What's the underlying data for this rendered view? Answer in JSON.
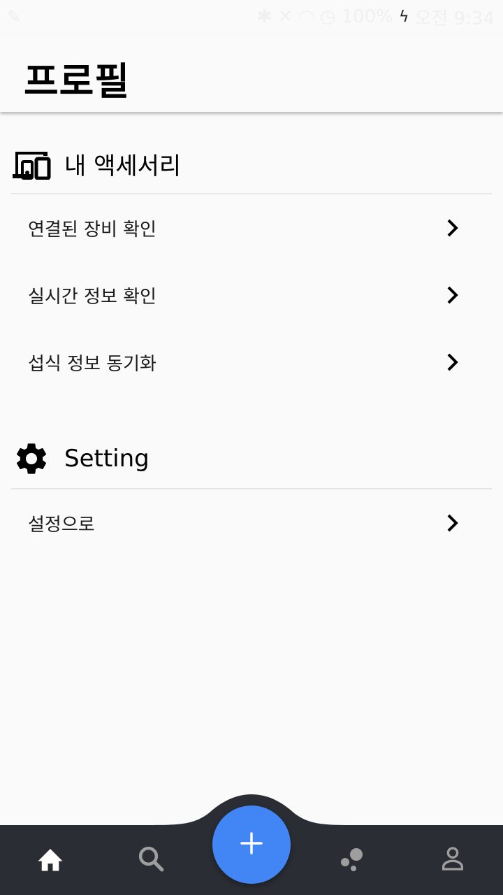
{
  "status_bar": {
    "battery": "100%",
    "time": "오전 9:34"
  },
  "app_bar": {
    "title": "프로필"
  },
  "sections": {
    "accessories": {
      "title": "내 액세서리",
      "icon": "devices-icon",
      "items": [
        {
          "label": "연결된 장비 확인"
        },
        {
          "label": "실시간 정보 확인"
        },
        {
          "label": "섭식 정보 동기화"
        }
      ]
    },
    "setting": {
      "title": "Setting",
      "icon": "gear-icon",
      "items": [
        {
          "label": "설정으로"
        }
      ]
    }
  },
  "bottom_nav": {
    "items": [
      {
        "icon": "home-icon"
      },
      {
        "icon": "search-icon"
      },
      {
        "icon": "add-icon"
      },
      {
        "icon": "bubbles-icon"
      },
      {
        "icon": "person-icon"
      }
    ],
    "colors": {
      "bar": "#2a2d33",
      "fab": "#4285f4",
      "active": "#ffffff",
      "inactive": "#9e9e9e"
    }
  }
}
